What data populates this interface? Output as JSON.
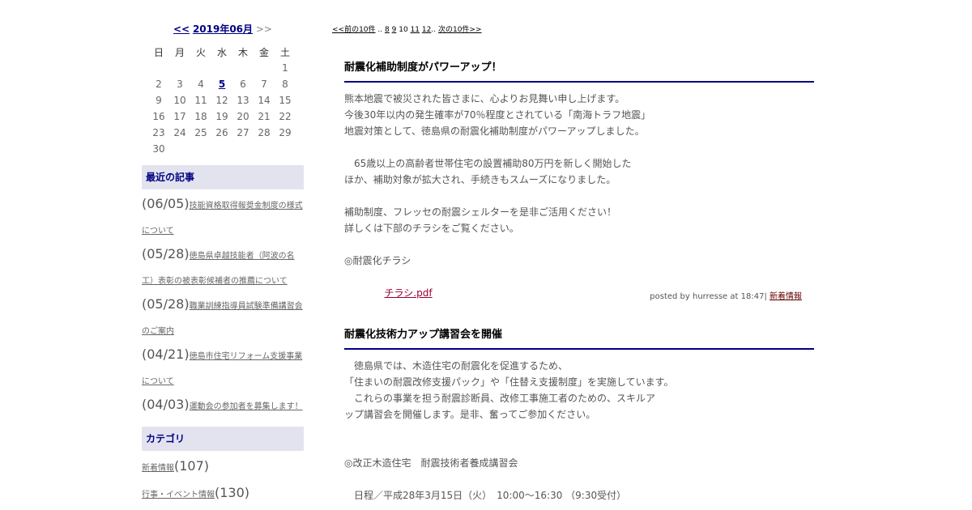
{
  "calendar": {
    "prev": "<<",
    "month": "2019年06月",
    "next": ">>",
    "weekdays": [
      "日",
      "月",
      "火",
      "水",
      "木",
      "金",
      "土"
    ],
    "weeks": [
      [
        "",
        "",
        "",
        "",
        "",
        "",
        "1"
      ],
      [
        "2",
        "3",
        "4",
        "5",
        "6",
        "7",
        "8"
      ],
      [
        "9",
        "10",
        "11",
        "12",
        "13",
        "14",
        "15"
      ],
      [
        "16",
        "17",
        "18",
        "19",
        "20",
        "21",
        "22"
      ],
      [
        "23",
        "24",
        "25",
        "26",
        "27",
        "28",
        "29"
      ],
      [
        "30",
        "",
        "",
        "",
        "",
        "",
        ""
      ]
    ],
    "today": "5"
  },
  "recent": {
    "heading": "最近の記事",
    "items": [
      {
        "date": "(06/05)",
        "title": "技能資格取得報奨金制度の様式について"
      },
      {
        "date": "(05/28)",
        "title": "徳島県卓越技能者（阿波の名工）表彰の被表彰候補者の推薦について"
      },
      {
        "date": "(05/28)",
        "title": "職業訓練指導員試験準備講習会のご案内"
      },
      {
        "date": "(04/21)",
        "title": "徳島市住宅リフォーム支援事業について"
      },
      {
        "date": "(04/03)",
        "title": "運動会の参加者を募集します！"
      }
    ]
  },
  "categories": {
    "heading": "カテゴリ",
    "items": [
      {
        "name": "新着情報",
        "count": "(107)"
      },
      {
        "name": "行事・イベント情報",
        "count": "(130)"
      }
    ]
  },
  "pager": {
    "prev": "<<前の10件",
    "dots1": "..",
    "p8": "8",
    "p9": "9",
    "current": "10",
    "p11": "11",
    "p12": "12",
    "dots2": "..",
    "next": "次の10件>>"
  },
  "entries": [
    {
      "title": "耐震化補助制度がパワーアップ！",
      "lines": [
        "熊本地震で被災された皆さまに、心よりお見舞い申し上げます。",
        "今後30年以内の発生確率が70％程度とされている「南海トラフ地震」",
        "地震対策として、徳島県の耐震化補助制度がパワーアップしました。",
        "",
        "　65歳以上の高齢者世帯住宅の設置補助80万円を新しく開始した",
        "ほか、補助対象が拡大され、手続きもスムーズになりました。",
        "",
        "補助制度、フレッセの耐震シェルターを是非ご活用ください！",
        "詳しくは下部のチラシをご覧ください。",
        "",
        "◎耐震化チラシ"
      ],
      "attachment": "チラシ.pdf",
      "posted_prefix": "posted by hurresse at 18:47|",
      "posted_category": "新着情報"
    },
    {
      "title": "耐震化技術力アップ講習会を開催",
      "lines": [
        "　徳島県では、木造住宅の耐震化を促進するため、",
        "「住まいの耐震改修支援パック」や「住替え支援制度」を実施しています。",
        "　これらの事業を担う耐震診断員、改修工事施工者のための、スキルア",
        "ップ講習会を開催します。是非、奮ってご参加ください。",
        "",
        "",
        "◎改正木造住宅　耐震技術者養成講習会",
        "",
        "　日程／平成28年3月15日（火）　10:00～16:30 （9:30受付）"
      ]
    }
  ]
}
